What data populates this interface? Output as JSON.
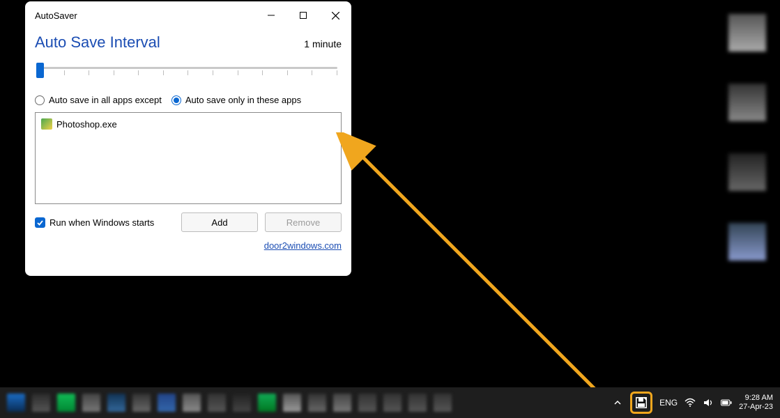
{
  "window": {
    "title": "AutoSaver",
    "heading": "Auto Save Interval",
    "interval_value": "1 minute",
    "radio_except": "Auto save in all apps except",
    "radio_only": "Auto save only in these apps",
    "radio_selected": "only",
    "apps": [
      "Photoshop.exe"
    ],
    "run_on_start_label": "Run when Windows starts",
    "run_on_start_checked": true,
    "btn_add": "Add",
    "btn_remove": "Remove",
    "link": "door2windows.com"
  },
  "taskbar": {
    "lang": "ENG",
    "time": "9:28 AM",
    "date": "27-Apr-23",
    "tray_highlight_icon": "floppy-save-icon"
  },
  "colors": {
    "accent": "#0a67d1",
    "annotation": "#f0a61e"
  }
}
